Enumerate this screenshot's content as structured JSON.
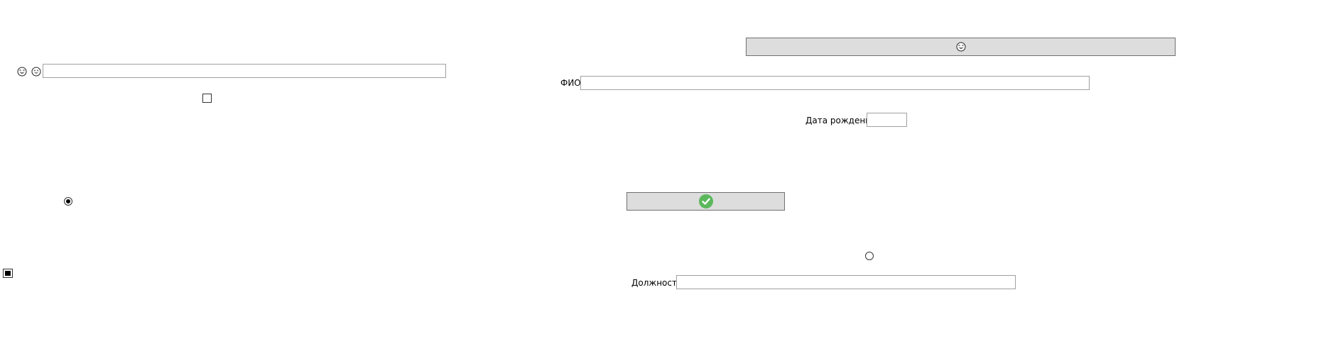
{
  "form": {
    "fio_label": "ФИО",
    "fio_value": "",
    "birth_label": "Дата рождения",
    "birth_value": "",
    "position_label": "Должность",
    "position_value": "",
    "top_left_field_value": ""
  },
  "controls": {
    "top_button_icon": "grinning-emoji-icon",
    "confirm_button_icon": "green-check-icon",
    "checkbox_checked": false,
    "checkbox_indeterminate": true,
    "radio_left_checked": true,
    "radio_right_checked": false
  },
  "colors": {
    "button_bg": "#dddddd",
    "check_green": "#5cb85c",
    "field_border": "#a0a0a0"
  }
}
